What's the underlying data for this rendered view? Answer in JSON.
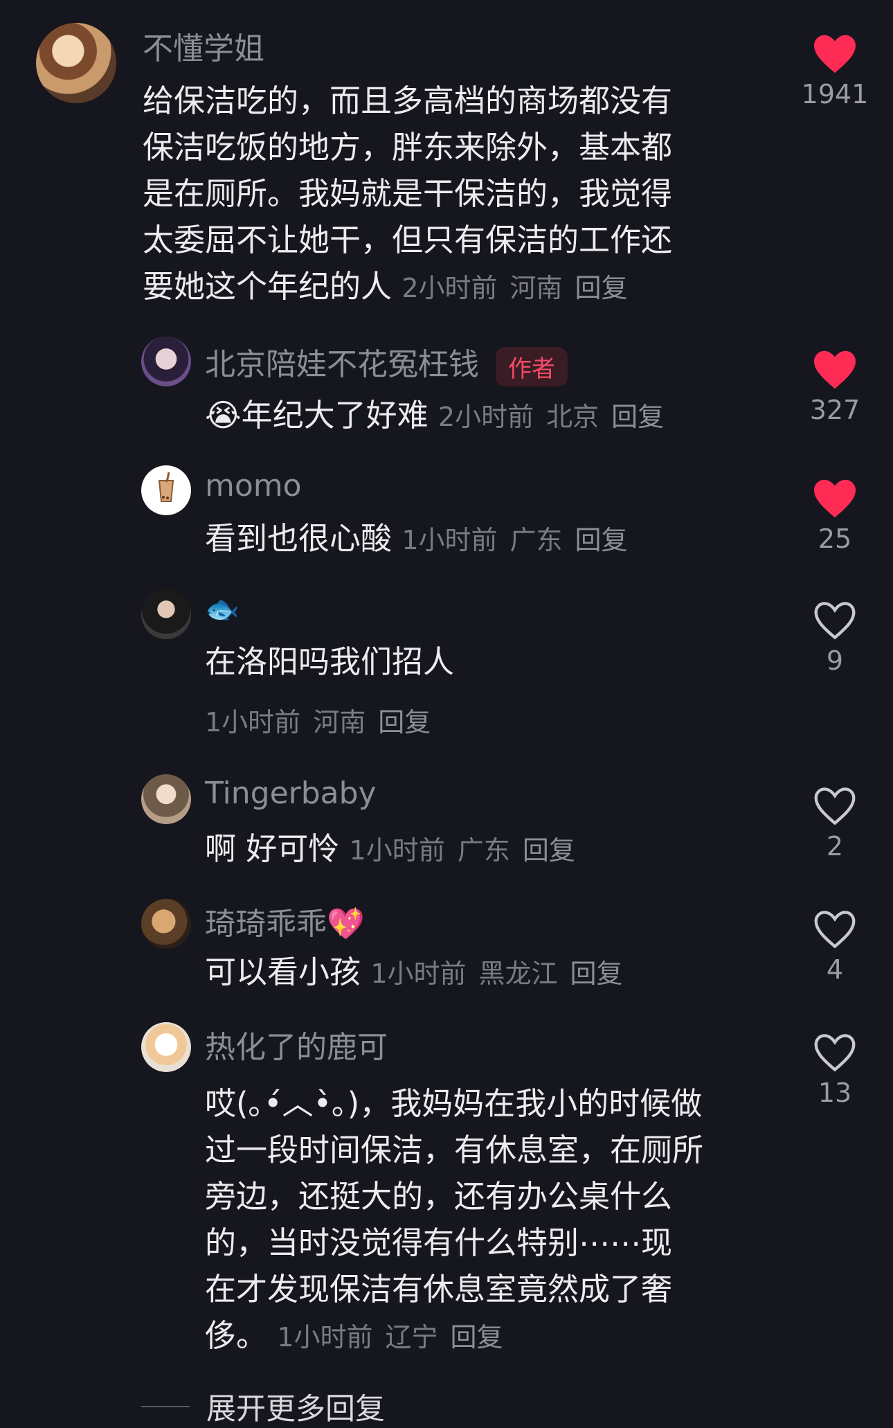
{
  "comments": [
    {
      "username": "不懂学姐",
      "lines": [
        "给保洁吃的，而且多高档的商场都没有",
        "保洁吃饭的地方，胖东来除外，基本都",
        "是在厕所。我妈就是干保洁的，我觉得",
        "太委屈不让她干，但只有保洁的工作还",
        "要她这个年纪的人"
      ],
      "time": "2小时前",
      "location": "河南",
      "reply_label": "回复",
      "likes": "1941",
      "liked": true
    },
    {
      "username": "北京陪娃不花冤枉钱",
      "badge": "作者",
      "lines": [
        "年纪大了好难"
      ],
      "time": "2小时前",
      "location": "北京",
      "reply_label": "回复",
      "likes": "327",
      "liked": true
    },
    {
      "username": "momo",
      "lines": [
        "看到也很心酸"
      ],
      "time": "1小时前",
      "location": "广东",
      "reply_label": "回复",
      "likes": "25",
      "liked": true
    },
    {
      "username": "🐟",
      "lines": [
        "在洛阳吗我们招人"
      ],
      "time": "1小时前",
      "location": "河南",
      "reply_label": "回复",
      "likes": "9",
      "liked": false
    },
    {
      "username": "Tingerbaby",
      "lines": [
        "啊 好可怜"
      ],
      "time": "1小时前",
      "location": "广东",
      "reply_label": "回复",
      "likes": "2",
      "liked": false
    },
    {
      "username": "琦琦乖乖💖",
      "lines": [
        "可以看小孩"
      ],
      "time": "1小时前",
      "location": "黑龙江",
      "reply_label": "回复",
      "likes": "4",
      "liked": false
    },
    {
      "username": "热化了的鹿可",
      "lines": [
        "哎(｡•́︿•̀｡)，我妈妈在我小的时候做",
        "过一段时间保洁，有休息室，在厕所",
        "旁边，还挺大的，还有办公桌什么",
        "的，当时没觉得有什么特别⋯⋯现",
        "在才发现保洁有休息室竟然成了奢",
        "侈。"
      ],
      "time": "1小时前",
      "location": "辽宁",
      "reply_label": "回复",
      "likes": "13",
      "liked": false
    }
  ],
  "expand_label": "展开更多回复",
  "colors": {
    "liked": "#fe2c55",
    "unliked": "#c8c8cf",
    "background": "#16161e"
  },
  "icons": {
    "liked": "heart-filled-icon",
    "unliked": "heart-outline-icon"
  }
}
